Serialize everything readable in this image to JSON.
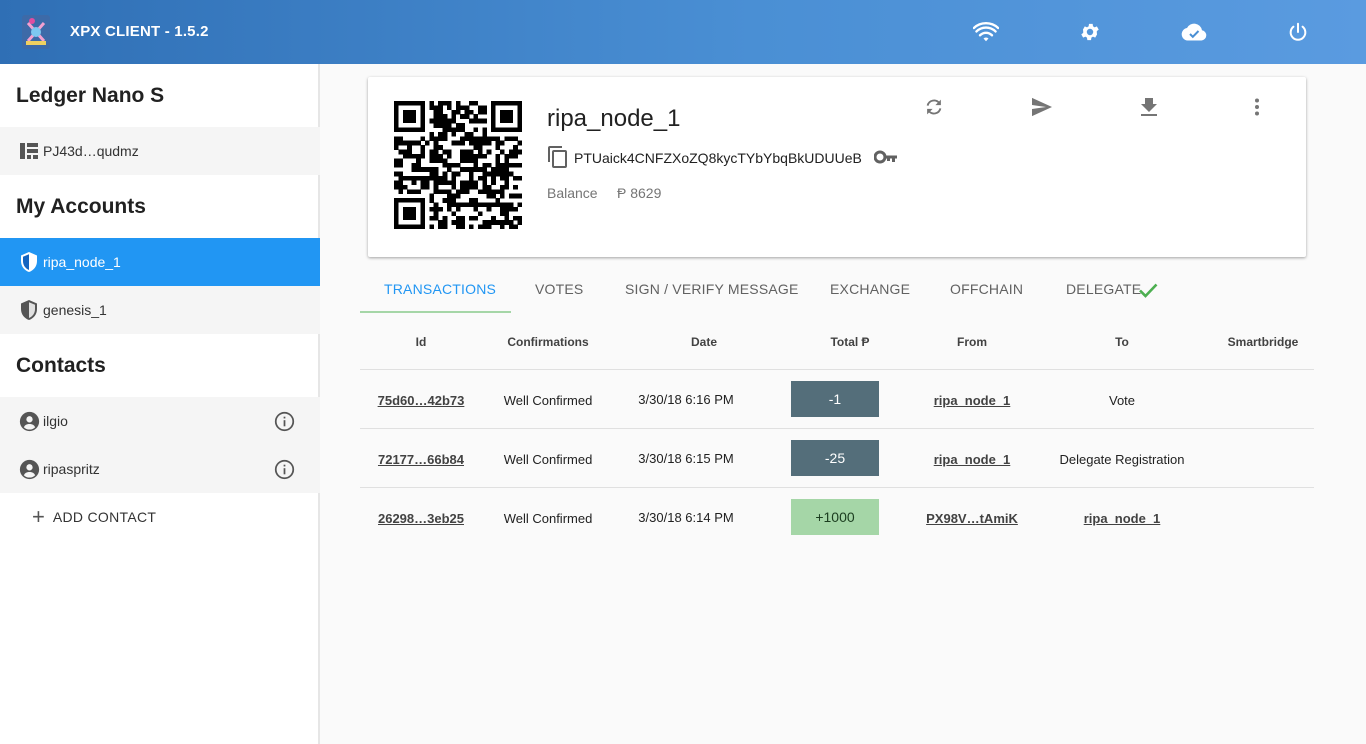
{
  "app": {
    "title": "XPX CLIENT - 1.5.2"
  },
  "header_icons": [
    "wifi-icon",
    "settings-icon",
    "cloud-done-icon",
    "power-icon"
  ],
  "sidebar": {
    "ledger_heading": "Ledger Nano S",
    "ledger_item": {
      "label": "PJ43d…qudmz",
      "icon": "ledger-device-icon"
    },
    "accounts_heading": "My Accounts",
    "accounts": [
      {
        "label": "ripa_node_1",
        "active": true,
        "icon": "shield-icon"
      },
      {
        "label": "genesis_1",
        "active": false,
        "icon": "shield-icon"
      }
    ],
    "contacts_heading": "Contacts",
    "contacts": [
      {
        "label": "ilgio",
        "icon": "account-circle-icon"
      },
      {
        "label": "ripaspritz",
        "icon": "account-circle-icon"
      }
    ],
    "add_contact_label": "ADD CONTACT"
  },
  "account": {
    "name": "ripa_node_1",
    "address": "PTUaick4CNFZXoZQ8kycTYbYbqBkUDUUeB",
    "balance_label": "Balance",
    "balance_value": "Ᵽ 8629",
    "actions": [
      "refresh-icon",
      "send-icon",
      "download-icon",
      "more-vert-icon"
    ]
  },
  "tabs": [
    {
      "label": "TRANSACTIONS",
      "active": true
    },
    {
      "label": "VOTES",
      "active": false
    },
    {
      "label": "SIGN / VERIFY MESSAGE",
      "active": false
    },
    {
      "label": "EXCHANGE",
      "active": false
    },
    {
      "label": "OFFCHAIN",
      "active": false
    },
    {
      "label": "DELEGATE",
      "active": false
    }
  ],
  "table": {
    "headers": [
      "Id",
      "Confirmations",
      "Date",
      "Total Ᵽ",
      "From",
      "To",
      "Smartbridge"
    ],
    "rows": [
      {
        "id": "75d60…42b73",
        "confirmations": "Well Confirmed",
        "date": "3/30/18 6:16 PM",
        "total": "-1",
        "from": "ripa_node_1",
        "to": "Vote",
        "to_link": false,
        "smartbridge": ""
      },
      {
        "id": "72177…66b84",
        "confirmations": "Well Confirmed",
        "date": "3/30/18 6:15 PM",
        "total": "-25",
        "from": "ripa_node_1",
        "to": "Delegate Registration",
        "to_link": false,
        "smartbridge": ""
      },
      {
        "id": "26298…3eb25",
        "confirmations": "Well Confirmed",
        "date": "3/30/18 6:14 PM",
        "total": "+1000",
        "from": "PX98V…tAmiK",
        "to": "ripa_node_1",
        "to_link": true,
        "smartbridge": ""
      }
    ]
  },
  "colors": {
    "accent": "#2196f3",
    "negative_amount": "#546e7a",
    "positive_amount": "#a5d6a7",
    "tab_ink": "#a5d6a7"
  }
}
